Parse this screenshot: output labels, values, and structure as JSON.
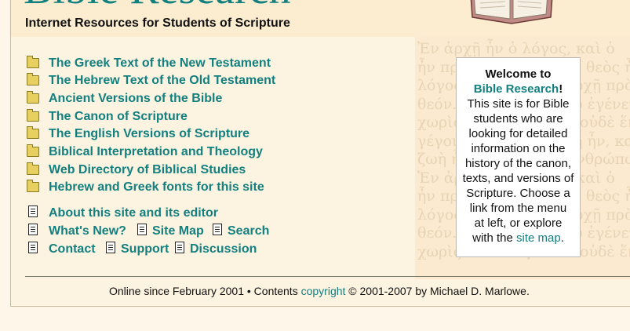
{
  "header": {
    "site_title": "Bible Research",
    "subtitle": "Internet Resources for Students of Scripture"
  },
  "background_text": {
    "lines": [
      "Ἐν ἀρχῇ ἦν ὁ λόγος, καὶ ὁ",
      "ἦν πρὸς τὸν θεόν, καὶ θεὸς ἦν",
      "λόγος. οὗτος ἦν ἐν ἀρχῇ πρὸς",
      "θεόν. πάντα δι' αὐτοῦ ἐγένετο,",
      "χωρὶς αὐτοῦ ἐγένετο οὐδὲ ἕν.",
      "γέγονεν. ἐν αὐτῷ ζωὴ ἦν, καὶ",
      "ζωὴ ἦν τὸ φῶς τῶν ἀνθρώπων.",
      "Ἐν ἀρχῇ ἦν ὁ λόγος, καὶ ὁ",
      "ἦν πρὸς τὸν θεόν, καὶ θεὸς ἦν",
      "λόγος. οὗτος ἦν ἐν ἀρχῇ πρὸς",
      "θεόν. πάντα δι' αὐτοῦ ἐγένετο,",
      "χωρὶς αὐτοῦ ἐγένετο οὐδὲ ἕν."
    ]
  },
  "nav": {
    "sections": [
      "The Greek Text of the New Testament",
      "The Hebrew Text of the Old Testament",
      "Ancient Versions of the Bible",
      "The Canon of Scripture",
      "The English Versions of Scripture",
      "Biblical Interpretation and Theology",
      "Web Directory of Biblical Studies",
      "Hebrew and Greek fonts for this site"
    ],
    "about": "About this site and its editor",
    "whats_new": "What's New?",
    "site_map": "Site Map",
    "search": "Search",
    "contact": "Contact",
    "support": "Support",
    "discussion": "Discussion"
  },
  "welcome": {
    "heading": "Welcome to",
    "name": "Bible Research",
    "exclamation": "!",
    "lines": [
      "This site is for Bible",
      "students who are",
      "looking for detailed",
      "information on the",
      "history of the canon,",
      "texts, and versions of",
      "Scripture. Choose a",
      "link from the menu",
      "at left, or explore"
    ],
    "last_prefix": "with the ",
    "site_map_link": "site map",
    "last_suffix": "."
  },
  "footer": {
    "prefix": "Online since February 2001 • Contents ",
    "copyright_link": "copyright",
    "suffix": " © 2001-2007 by Michael D. Marlowe."
  },
  "icons": {
    "section": "folder-icon",
    "page": "document-icon"
  },
  "colors": {
    "link": "#138080",
    "background": "#fdf3e1",
    "header": "#fdedd0",
    "panel": "#ffffff"
  }
}
